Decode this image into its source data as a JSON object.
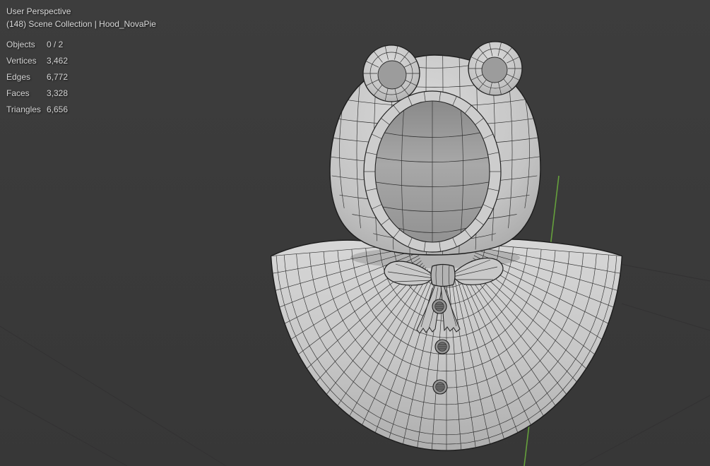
{
  "viewport": {
    "perspective_label": "User Perspective",
    "collection_label": "(148) Scene Collection | Hood_NovaPie",
    "stats": {
      "rows": [
        {
          "label": "Objects",
          "value": "0 / 2"
        },
        {
          "label": "Vertices",
          "value": "3,462"
        },
        {
          "label": "Edges",
          "value": "6,772"
        },
        {
          "label": "Faces",
          "value": "3,328"
        },
        {
          "label": "Triangles",
          "value": "6,656"
        }
      ]
    },
    "colors": {
      "background": "#3a3a3a",
      "surface": "#c8c8c8",
      "wireframe": "#2e2e2e",
      "axis_green": "#65A03C",
      "overlay_text": "#d8d8d8"
    }
  }
}
